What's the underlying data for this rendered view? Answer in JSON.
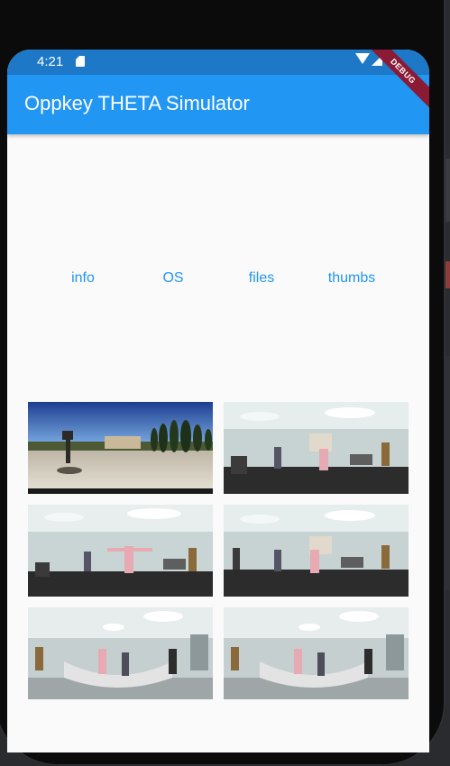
{
  "status_bar": {
    "time": "4:21"
  },
  "app_bar": {
    "title": "Oppkey THETA Simulator"
  },
  "debug_banner": "DEBUG",
  "buttons": [
    {
      "label": "info"
    },
    {
      "label": "OS"
    },
    {
      "label": "files"
    },
    {
      "label": "thumbs"
    }
  ],
  "thumbnails": [
    {
      "scene": "outdoor-statue-garden"
    },
    {
      "scene": "office-group-a"
    },
    {
      "scene": "office-group-b"
    },
    {
      "scene": "office-group-a"
    },
    {
      "scene": "office-lobby"
    },
    {
      "scene": "office-lobby"
    }
  ],
  "colors": {
    "app_bar": "#2196f3",
    "status_bar": "#1e78c8",
    "button_text": "#2196f3",
    "background": "#fafafa"
  }
}
